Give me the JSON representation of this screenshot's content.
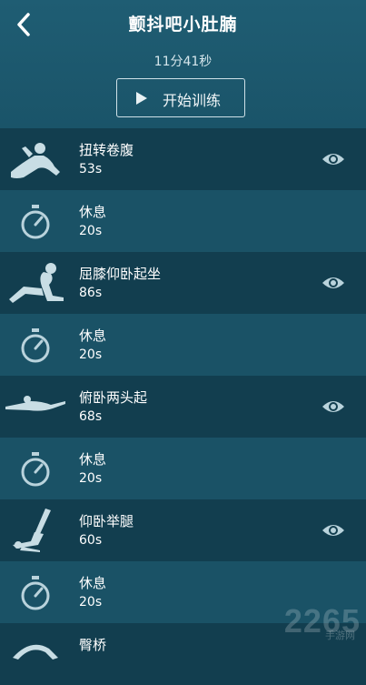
{
  "header": {
    "title": "颤抖吧小肚腩",
    "duration": "11分41秒",
    "start_label": "开始训练"
  },
  "rows": [
    {
      "name": "扭转卷腹",
      "duration": "53s"
    },
    {
      "name": "休息",
      "duration": "20s"
    },
    {
      "name": "屈膝仰卧起坐",
      "duration": "86s"
    },
    {
      "name": "休息",
      "duration": "20s"
    },
    {
      "name": "俯卧两头起",
      "duration": "68s"
    },
    {
      "name": "休息",
      "duration": "20s"
    },
    {
      "name": "仰卧举腿",
      "duration": "60s"
    },
    {
      "name": "休息",
      "duration": "20s"
    },
    {
      "name": "臀桥",
      "duration": ""
    }
  ],
  "watermark": {
    "main": "2265",
    "sub": "手游网"
  },
  "colors": {
    "header_bg": "#1f5d73",
    "exercise_row_bg": "#123e4f",
    "rest_row_bg": "#1a5266",
    "icon": "#b9d3dc"
  }
}
